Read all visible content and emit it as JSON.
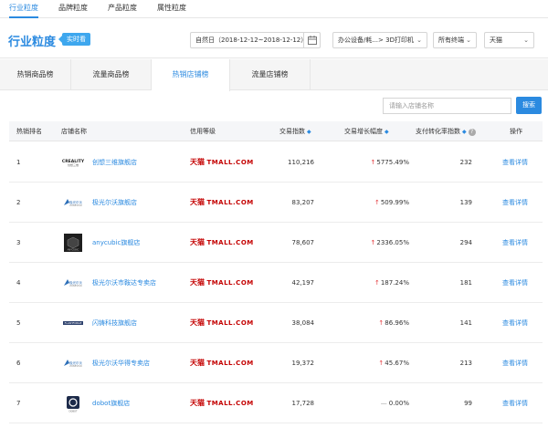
{
  "top_tabs": [
    "行业粒度",
    "品牌粒度",
    "产品粒度",
    "属性粒度"
  ],
  "page_title": "行业粒度",
  "badge": "实时看",
  "date_range": "自然日（2018-12-12~2018-12-12）",
  "category": "办公设备/耗...> 3D打印机",
  "terminal": "所有终端",
  "platform": "天猫",
  "sub_tabs": [
    "热销商品榜",
    "流量商品榜",
    "热销店铺榜",
    "流量店铺榜"
  ],
  "search": {
    "placeholder": "请输入店铺名称",
    "button": "搜索"
  },
  "table": {
    "headers": {
      "rank": "热销排名",
      "shop": "店铺名称",
      "credit": "信用等级",
      "trade_index": "交易指数",
      "growth": "交易增长幅度",
      "conversion": "支付转化率指数",
      "action": "操作"
    },
    "sort_icon": "◆",
    "help_icon": "?",
    "up_arrow": "↑",
    "flat_arrow": "—",
    "tmall_cn": "天猫",
    "tmall_en": "TMALL.COM",
    "rows": [
      {
        "rank": "1",
        "shop": "创想三维旗舰店",
        "trade_index": "110,216",
        "growth": "5775.49%",
        "trend": "up",
        "conversion": "232",
        "action": "查看详情",
        "logo": "creality-logo"
      },
      {
        "rank": "2",
        "shop": "极光尔沃旗舰店",
        "trade_index": "83,207",
        "growth": "509.99%",
        "trend": "up",
        "conversion": "139",
        "action": "查看详情",
        "logo": "zonestar-logo"
      },
      {
        "rank": "3",
        "shop": "anycubic旗舰店",
        "trade_index": "78,607",
        "growth": "2336.05%",
        "trend": "up",
        "conversion": "294",
        "action": "查看详情",
        "logo": "anycubic-logo"
      },
      {
        "rank": "4",
        "shop": "极光尔沃市鞍达专卖店",
        "trade_index": "42,197",
        "growth": "187.24%",
        "trend": "up",
        "conversion": "181",
        "action": "查看详情",
        "logo": "zonestar-logo"
      },
      {
        "rank": "5",
        "shop": "闪铸科技旗舰店",
        "trade_index": "38,084",
        "growth": "86.96%",
        "trend": "up",
        "conversion": "141",
        "action": "查看详情",
        "logo": "flashforge-logo"
      },
      {
        "rank": "6",
        "shop": "极光尔沃华得专卖店",
        "trade_index": "19,372",
        "growth": "45.67%",
        "trend": "up",
        "conversion": "213",
        "action": "查看详情",
        "logo": "zonestar-logo"
      },
      {
        "rank": "7",
        "shop": "dobot旗舰店",
        "trade_index": "17,728",
        "growth": "0.00%",
        "trend": "flat",
        "conversion": "99",
        "action": "查看详情",
        "logo": "dobot-logo"
      }
    ]
  },
  "colors": {
    "accent": "#2b8ae0",
    "tmall_red": "#c40000",
    "up_red": "#e4393c"
  }
}
